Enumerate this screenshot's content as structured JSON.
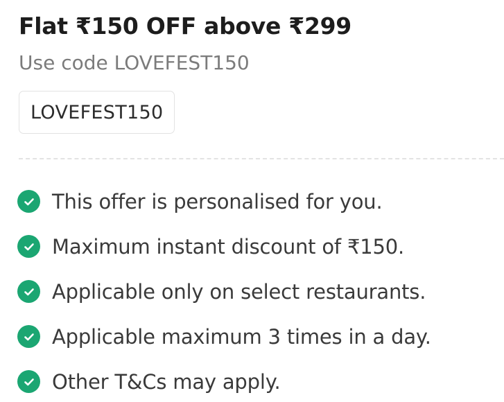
{
  "offer": {
    "title": "Flat ₹150 OFF above ₹299",
    "subtitle": "Use code LOVEFEST150",
    "code": "LOVEFEST150"
  },
  "terms": [
    {
      "icon": "check-circle-icon",
      "text": "This offer is personalised for you."
    },
    {
      "icon": "check-circle-icon",
      "text": "Maximum instant discount of ₹150."
    },
    {
      "icon": "check-circle-icon",
      "text": "Applicable only on select restaurants."
    },
    {
      "icon": "check-circle-icon",
      "text": "Applicable maximum 3 times in a day."
    },
    {
      "icon": "check-circle-icon",
      "text": "Other T&Cs may apply."
    }
  ],
  "colors": {
    "check_green": "#1ba672",
    "title_text": "#1d1d1d",
    "subtitle_text": "#7b7b7b"
  }
}
